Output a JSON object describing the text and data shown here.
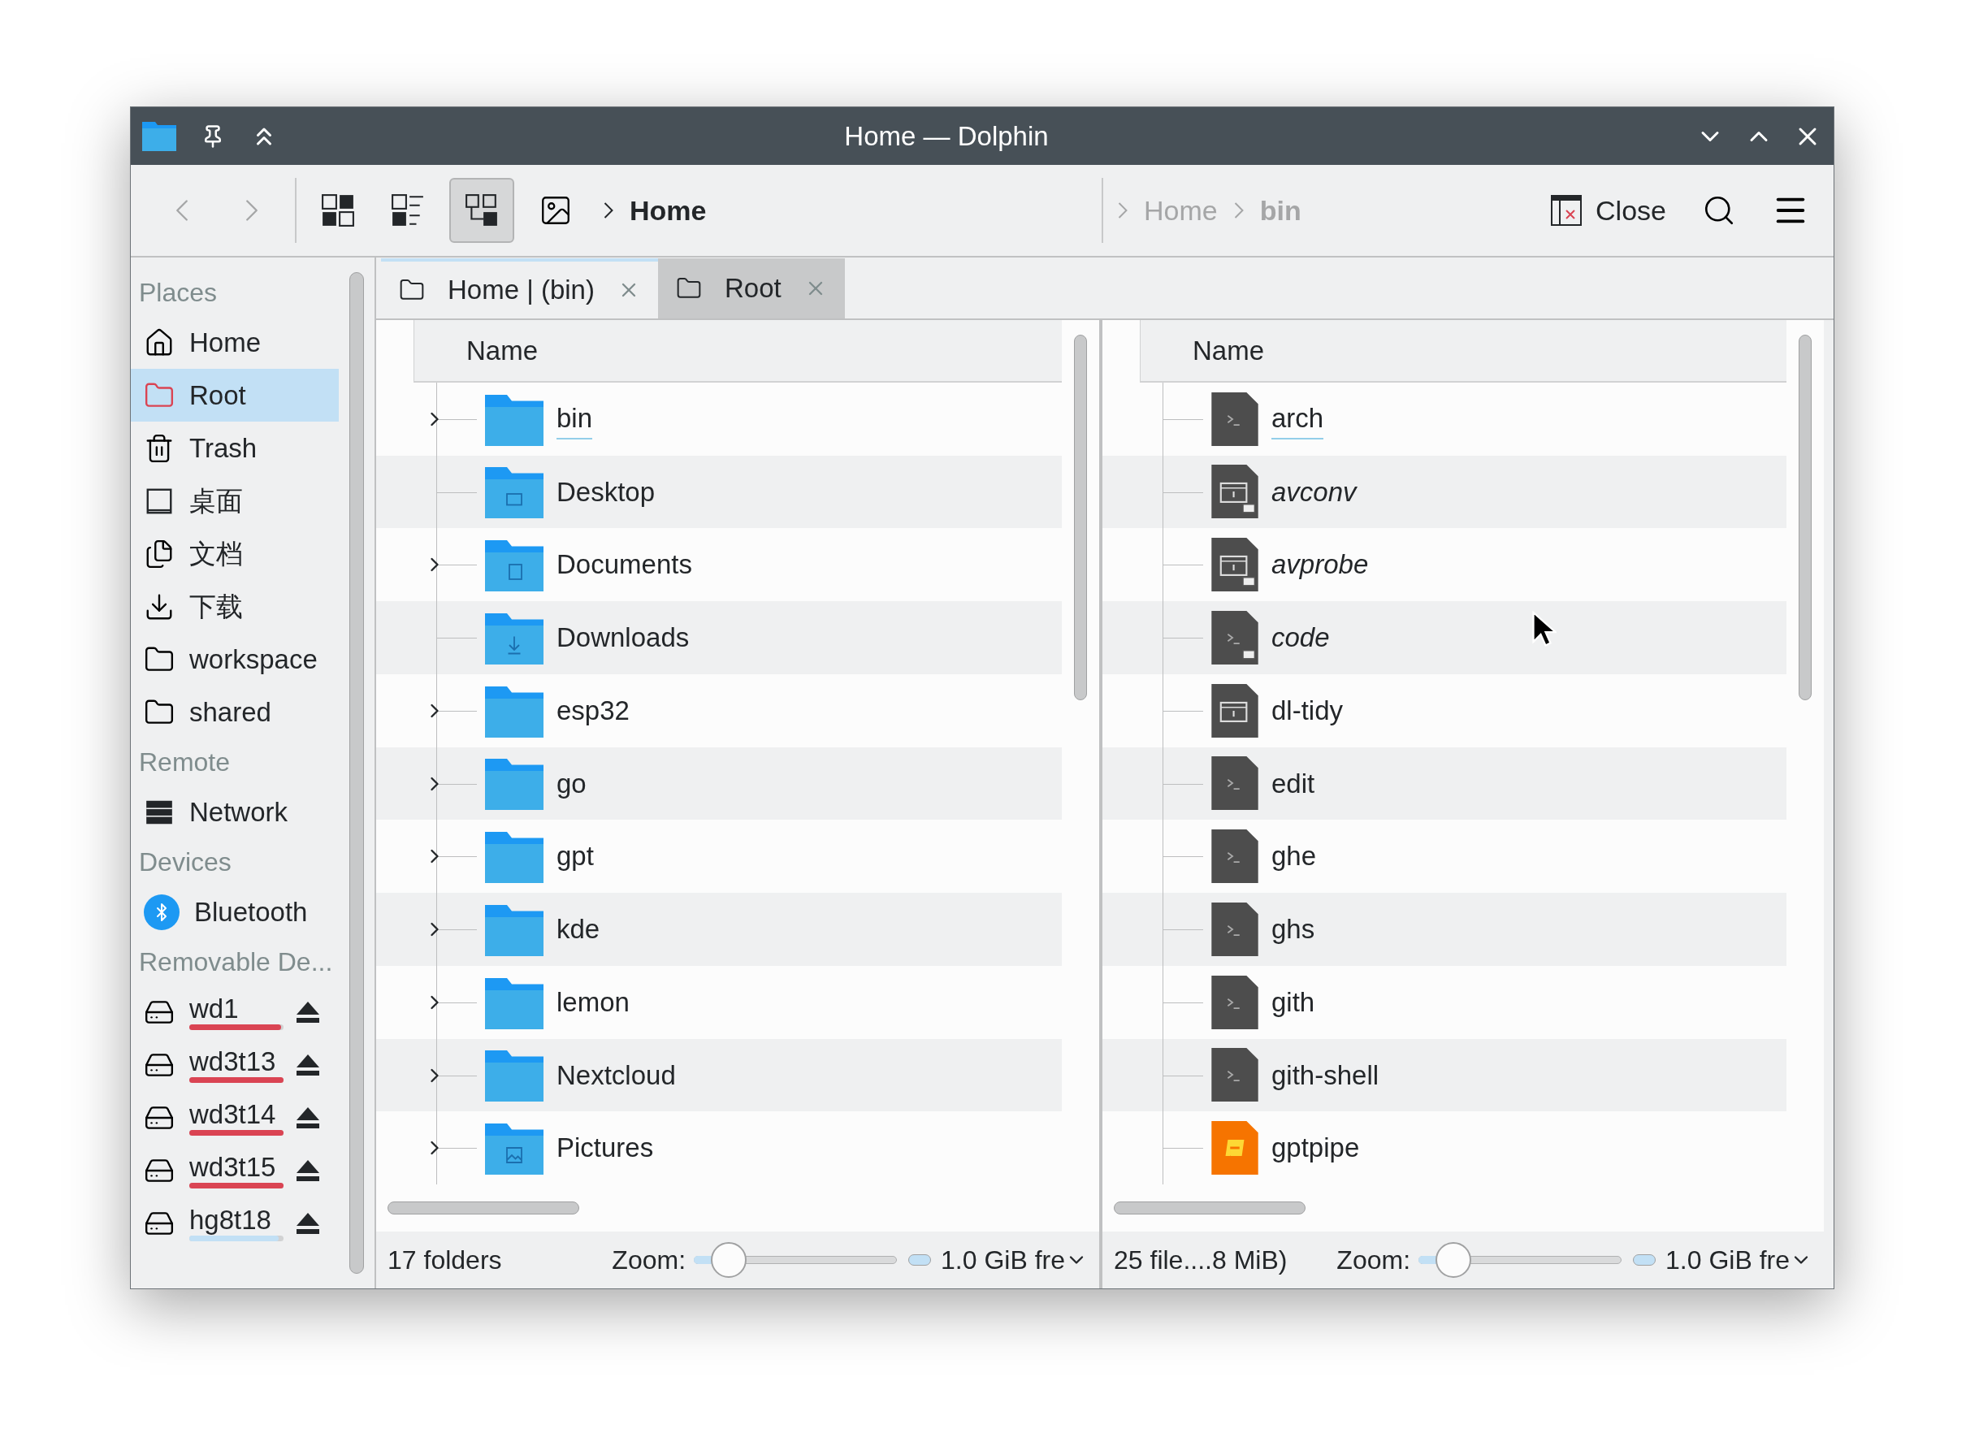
{
  "window": {
    "title": "Home — Dolphin"
  },
  "toolbar": {
    "close_label": "Close"
  },
  "sidebar": {
    "sections": [
      {
        "heading": "Places",
        "items": [
          {
            "label": "Home",
            "kind": "home",
            "selected": false
          },
          {
            "label": "Root",
            "kind": "root",
            "selected": true
          },
          {
            "label": "Trash",
            "kind": "trash",
            "selected": false
          },
          {
            "label": "桌面",
            "kind": "desktop",
            "selected": false
          },
          {
            "label": "文档",
            "kind": "documents",
            "selected": false
          },
          {
            "label": "下载",
            "kind": "downloads",
            "selected": false
          },
          {
            "label": "workspace",
            "kind": "folder",
            "selected": false
          },
          {
            "label": "shared",
            "kind": "folder",
            "selected": false
          }
        ]
      },
      {
        "heading": "Remote",
        "items": [
          {
            "label": "Network",
            "kind": "network",
            "selected": false
          }
        ]
      },
      {
        "heading": "Devices",
        "items": [
          {
            "label": "Bluetooth",
            "kind": "bluetooth",
            "selected": false
          }
        ]
      },
      {
        "heading": "Removable De...",
        "items": [
          {
            "label": "wd1",
            "kind": "drive",
            "selected": false,
            "level": 0.97,
            "warning": true
          },
          {
            "label": "wd3t13",
            "kind": "drive",
            "selected": false,
            "level": 1,
            "warning": true
          },
          {
            "label": "wd3t14",
            "kind": "drive",
            "selected": false,
            "level": 1,
            "warning": true
          },
          {
            "label": "wd3t15",
            "kind": "drive",
            "selected": false,
            "level": 1,
            "warning": true
          },
          {
            "label": "hg8t18",
            "kind": "drive",
            "selected": false,
            "level": 0.95,
            "warning": false
          }
        ]
      }
    ]
  },
  "tabs": [
    {
      "label": "Home | (bin)",
      "selected": true
    },
    {
      "label": "Root",
      "selected": false
    }
  ],
  "views": [
    {
      "active": true,
      "breadcrumb": [
        {
          "label": "Home"
        }
      ],
      "column": "Name",
      "rows": [
        {
          "name": "bin",
          "kind": "folder",
          "expandable": true,
          "highlighted": true,
          "symlink": false
        },
        {
          "name": "Desktop",
          "kind": "folder-desktop",
          "expandable": false,
          "highlighted": false,
          "symlink": false
        },
        {
          "name": "Documents",
          "kind": "folder-documents",
          "expandable": true,
          "highlighted": false,
          "symlink": false
        },
        {
          "name": "Downloads",
          "kind": "folder-downloads",
          "expandable": false,
          "highlighted": false,
          "symlink": false
        },
        {
          "name": "esp32",
          "kind": "folder",
          "expandable": true,
          "highlighted": false,
          "symlink": false
        },
        {
          "name": "go",
          "kind": "folder",
          "expandable": true,
          "highlighted": false,
          "symlink": false
        },
        {
          "name": "gpt",
          "kind": "folder",
          "expandable": true,
          "highlighted": false,
          "symlink": false
        },
        {
          "name": "kde",
          "kind": "folder",
          "expandable": true,
          "highlighted": false,
          "symlink": false
        },
        {
          "name": "lemon",
          "kind": "folder",
          "expandable": true,
          "highlighted": false,
          "symlink": false
        },
        {
          "name": "Nextcloud",
          "kind": "folder",
          "expandable": true,
          "highlighted": false,
          "symlink": false
        },
        {
          "name": "Pictures",
          "kind": "folder-pictures",
          "expandable": true,
          "highlighted": false,
          "symlink": false
        }
      ],
      "status": "17 folders",
      "zoom": {
        "label": "Zoom:",
        "level": 0.17
      },
      "free_space": "1.0 GiB fre"
    },
    {
      "active": false,
      "breadcrumb": [
        {
          "label": "Home"
        },
        {
          "label": "bin"
        }
      ],
      "column": "Name",
      "rows": [
        {
          "name": "arch",
          "kind": "script",
          "expandable": false,
          "highlighted": true,
          "symlink": false
        },
        {
          "name": "avconv",
          "kind": "exec",
          "expandable": false,
          "highlighted": false,
          "symlink": true
        },
        {
          "name": "avprobe",
          "kind": "exec",
          "expandable": false,
          "highlighted": false,
          "symlink": true
        },
        {
          "name": "code",
          "kind": "script",
          "expandable": false,
          "highlighted": false,
          "symlink": true
        },
        {
          "name": "dl-tidy",
          "kind": "exec",
          "expandable": false,
          "highlighted": false,
          "symlink": false
        },
        {
          "name": "edit",
          "kind": "script",
          "expandable": false,
          "highlighted": false,
          "symlink": false
        },
        {
          "name": "ghe",
          "kind": "script",
          "expandable": false,
          "highlighted": false,
          "symlink": false
        },
        {
          "name": "ghs",
          "kind": "script",
          "expandable": false,
          "highlighted": false,
          "symlink": false
        },
        {
          "name": "gith",
          "kind": "script",
          "expandable": false,
          "highlighted": false,
          "symlink": false
        },
        {
          "name": "gith-shell",
          "kind": "script",
          "expandable": false,
          "highlighted": false,
          "symlink": false
        },
        {
          "name": "gptpipe",
          "kind": "python",
          "expandable": false,
          "highlighted": false,
          "symlink": false
        }
      ],
      "status": "25 file....8 MiB)",
      "zoom": {
        "label": "Zoom:",
        "level": 0.17
      },
      "free_space": "1.0 GiB fre"
    }
  ]
}
